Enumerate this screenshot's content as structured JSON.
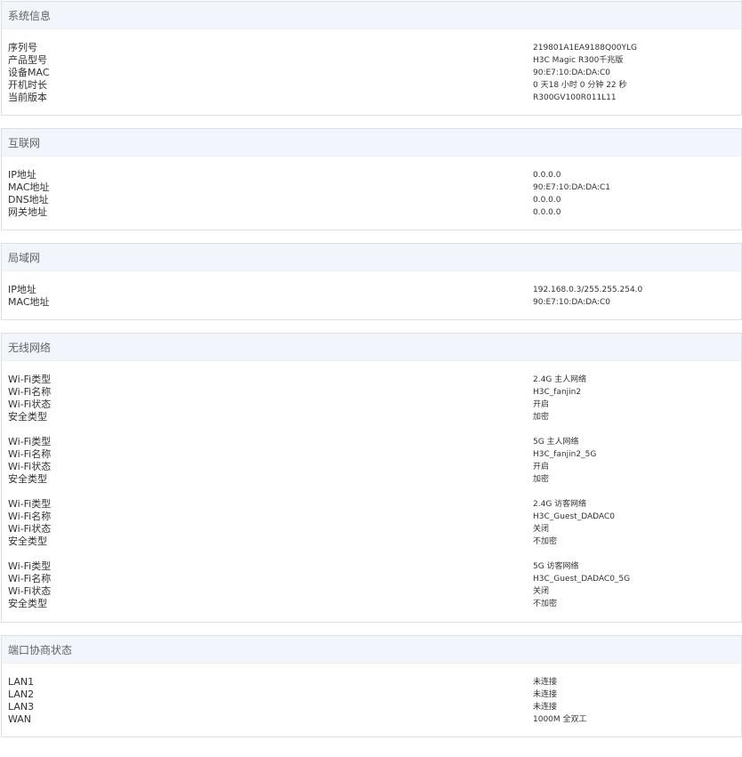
{
  "system_info": {
    "title": "系统信息",
    "rows": [
      {
        "label": "序列号",
        "value": "219801A1EA9188Q00YLG"
      },
      {
        "label": "产品型号",
        "value": "H3C Magic R300千兆版"
      },
      {
        "label": "设备MAC",
        "value": "90:E7:10:DA:DA:C0"
      },
      {
        "label": "开机时长",
        "value": "0 天18 小时 0 分钟 22 秒"
      },
      {
        "label": "当前版本",
        "value": "R300GV100R011L11"
      }
    ]
  },
  "internet": {
    "title": "互联网",
    "rows": [
      {
        "label": "IP地址",
        "value": "0.0.0.0"
      },
      {
        "label": "MAC地址",
        "value": "90:E7:10:DA:DA:C1"
      },
      {
        "label": "DNS地址",
        "value": "0.0.0.0"
      },
      {
        "label": "网关地址",
        "value": "0.0.0.0"
      }
    ]
  },
  "lan": {
    "title": "局域网",
    "rows": [
      {
        "label": "IP地址",
        "value": "192.168.0.3/255.255.254.0"
      },
      {
        "label": "MAC地址",
        "value": "90:E7:10:DA:DA:C0"
      }
    ]
  },
  "wireless": {
    "title": "无线网络",
    "groups": [
      {
        "rows": [
          {
            "label": "Wi-Fi类型",
            "value": "2.4G 主人网络"
          },
          {
            "label": "Wi-Fi名称",
            "value": "H3C_fanjin2"
          },
          {
            "label": "Wi-Fi状态",
            "value": "开启"
          },
          {
            "label": "安全类型",
            "value": "加密"
          }
        ]
      },
      {
        "rows": [
          {
            "label": "Wi-Fi类型",
            "value": "5G 主人网络"
          },
          {
            "label": "Wi-Fi名称",
            "value": "H3C_fanjin2_5G"
          },
          {
            "label": "Wi-Fi状态",
            "value": "开启"
          },
          {
            "label": "安全类型",
            "value": "加密"
          }
        ]
      },
      {
        "rows": [
          {
            "label": "Wi-Fi类型",
            "value": "2.4G 访客网络"
          },
          {
            "label": "Wi-Fi名称",
            "value": "H3C_Guest_DADAC0"
          },
          {
            "label": "Wi-Fi状态",
            "value": "关闭"
          },
          {
            "label": "安全类型",
            "value": "不加密"
          }
        ]
      },
      {
        "rows": [
          {
            "label": "Wi-Fi类型",
            "value": "5G 访客网络"
          },
          {
            "label": "Wi-Fi名称",
            "value": "H3C_Guest_DADAC0_5G"
          },
          {
            "label": "Wi-Fi状态",
            "value": "关闭"
          },
          {
            "label": "安全类型",
            "value": "不加密"
          }
        ]
      }
    ]
  },
  "ports": {
    "title": "端口协商状态",
    "rows": [
      {
        "label": "LAN1",
        "value": "未连接"
      },
      {
        "label": "LAN2",
        "value": "未连接"
      },
      {
        "label": "LAN3",
        "value": "未连接"
      },
      {
        "label": "WAN",
        "value": "1000M 全双工"
      }
    ]
  }
}
